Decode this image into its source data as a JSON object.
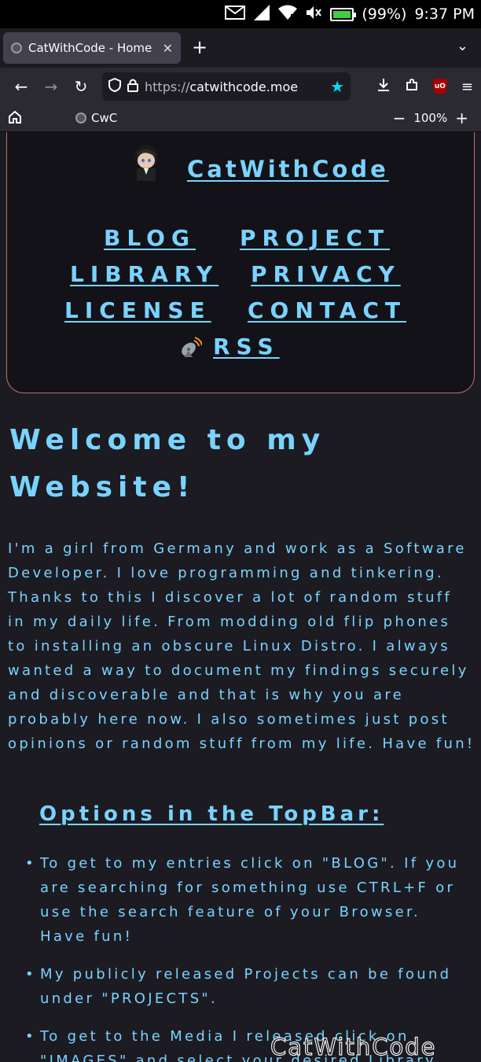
{
  "status_bar": {
    "battery": "(99%)",
    "time": "9:37 PM",
    "icons": [
      "mail-icon",
      "signal-icon",
      "wifi-icon",
      "mute-icon",
      "battery-icon"
    ]
  },
  "tabs": [
    {
      "title": "CatWithCode - Home",
      "active": true
    }
  ],
  "nav": {
    "url_proto": "https://",
    "url_host": "catwithcode.moe"
  },
  "bookmarks": {
    "items": [
      {
        "label": "CwC"
      }
    ],
    "zoom": "100%"
  },
  "page": {
    "site_title": "CatWithCode",
    "nav_links": [
      {
        "label": "BLOG"
      },
      {
        "label": "PROJECT"
      },
      {
        "label": "LIBRARY"
      },
      {
        "label": "PRIVACY"
      },
      {
        "label": "LICENSE"
      },
      {
        "label": "CONTACT"
      },
      {
        "label": "RSS"
      }
    ],
    "welcome": "Welcome to my Website!",
    "intro": "I'm a girl from Germany and work as a Software Developer. I love programming and tinkering. Thanks to this I discover a lot of random stuff in my daily life. From modding old flip phones to installing an obscure Linux Distro. I always wanted a way to document my findings securely and discoverable and that is why you are probably here now. I also sometimes just post opinions or random stuff from my life. Have fun!",
    "options_heading": "Options in the TopBar:",
    "options": [
      "To get to my entries click on \"BLOG\". If you are searching for something use CTRL+F or use the search feature of your Browser. Have fun!",
      "My publicly released Projects can be found under \"PROJECTS\".",
      "To get to the Media I released click on \"IMAGES\" and select your desired Library"
    ]
  },
  "watermark": "CatWithCode",
  "colors": {
    "accent": "#79d3ff",
    "page_bg": "#1c1b22",
    "topbar_bg": "#131218",
    "topbar_border": "#c86d6d"
  }
}
